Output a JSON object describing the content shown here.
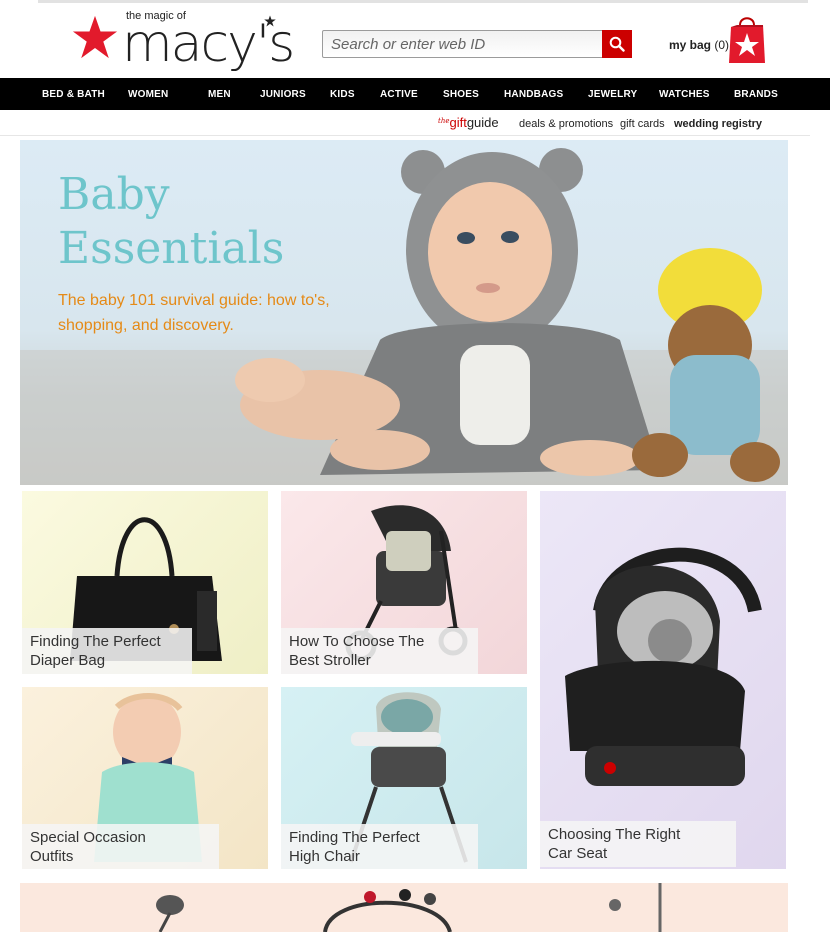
{
  "header": {
    "tagline": "the magic of",
    "logo_word": "macy's",
    "search": {
      "placeholder": "Search or enter web ID",
      "value": ""
    },
    "bag": {
      "label": "my bag",
      "count": "(0)"
    }
  },
  "nav": {
    "items": [
      "BED & BATH",
      "WOMEN",
      "MEN",
      "JUNIORS",
      "KIDS",
      "ACTIVE",
      "SHOES",
      "HANDBAGS",
      "JEWELRY",
      "WATCHES",
      "BRANDS"
    ]
  },
  "subnav": {
    "gift_the": "the",
    "gift_word": "gift",
    "guide_word": "guide",
    "deals": "deals & promotions",
    "gift_cards": "gift cards",
    "wedding": "wedding registry"
  },
  "hero": {
    "title_line1": "Baby",
    "title_line2": "Essentials",
    "subtitle": "The baby 101 survival guide: how to's, shopping, and discovery."
  },
  "tiles": [
    {
      "line1": "Finding The Perfect",
      "line2": "Diaper Bag"
    },
    {
      "line1": "How To Choose The",
      "line2": "Best Stroller"
    },
    {
      "line1": "Choosing The Right",
      "line2": "Car Seat"
    },
    {
      "line1": "Special Occasion",
      "line2": "Outfits"
    },
    {
      "line1": "Finding The Perfect",
      "line2": "High Chair"
    }
  ],
  "colors": {
    "brand_red": "#cc0000",
    "hero_title": "#6ec5cb",
    "hero_sub": "#e58a17"
  }
}
